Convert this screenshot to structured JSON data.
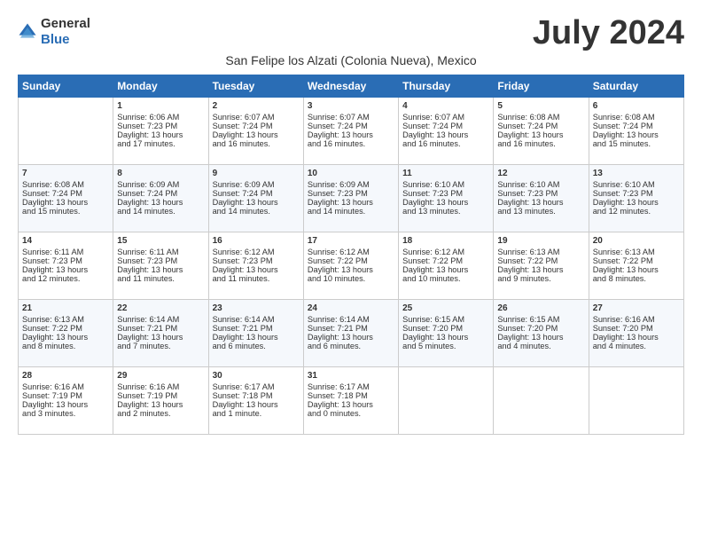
{
  "logo": {
    "general": "General",
    "blue": "Blue"
  },
  "title": "July 2024",
  "subtitle": "San Felipe los Alzati (Colonia Nueva), Mexico",
  "days_of_week": [
    "Sunday",
    "Monday",
    "Tuesday",
    "Wednesday",
    "Thursday",
    "Friday",
    "Saturday"
  ],
  "weeks": [
    [
      {
        "day": "",
        "content": ""
      },
      {
        "day": "1",
        "content": "Sunrise: 6:06 AM\nSunset: 7:23 PM\nDaylight: 13 hours\nand 17 minutes."
      },
      {
        "day": "2",
        "content": "Sunrise: 6:07 AM\nSunset: 7:24 PM\nDaylight: 13 hours\nand 16 minutes."
      },
      {
        "day": "3",
        "content": "Sunrise: 6:07 AM\nSunset: 7:24 PM\nDaylight: 13 hours\nand 16 minutes."
      },
      {
        "day": "4",
        "content": "Sunrise: 6:07 AM\nSunset: 7:24 PM\nDaylight: 13 hours\nand 16 minutes."
      },
      {
        "day": "5",
        "content": "Sunrise: 6:08 AM\nSunset: 7:24 PM\nDaylight: 13 hours\nand 16 minutes."
      },
      {
        "day": "6",
        "content": "Sunrise: 6:08 AM\nSunset: 7:24 PM\nDaylight: 13 hours\nand 15 minutes."
      }
    ],
    [
      {
        "day": "7",
        "content": "Sunrise: 6:08 AM\nSunset: 7:24 PM\nDaylight: 13 hours\nand 15 minutes."
      },
      {
        "day": "8",
        "content": "Sunrise: 6:09 AM\nSunset: 7:24 PM\nDaylight: 13 hours\nand 14 minutes."
      },
      {
        "day": "9",
        "content": "Sunrise: 6:09 AM\nSunset: 7:24 PM\nDaylight: 13 hours\nand 14 minutes."
      },
      {
        "day": "10",
        "content": "Sunrise: 6:09 AM\nSunset: 7:23 PM\nDaylight: 13 hours\nand 14 minutes."
      },
      {
        "day": "11",
        "content": "Sunrise: 6:10 AM\nSunset: 7:23 PM\nDaylight: 13 hours\nand 13 minutes."
      },
      {
        "day": "12",
        "content": "Sunrise: 6:10 AM\nSunset: 7:23 PM\nDaylight: 13 hours\nand 13 minutes."
      },
      {
        "day": "13",
        "content": "Sunrise: 6:10 AM\nSunset: 7:23 PM\nDaylight: 13 hours\nand 12 minutes."
      }
    ],
    [
      {
        "day": "14",
        "content": "Sunrise: 6:11 AM\nSunset: 7:23 PM\nDaylight: 13 hours\nand 12 minutes."
      },
      {
        "day": "15",
        "content": "Sunrise: 6:11 AM\nSunset: 7:23 PM\nDaylight: 13 hours\nand 11 minutes."
      },
      {
        "day": "16",
        "content": "Sunrise: 6:12 AM\nSunset: 7:23 PM\nDaylight: 13 hours\nand 11 minutes."
      },
      {
        "day": "17",
        "content": "Sunrise: 6:12 AM\nSunset: 7:22 PM\nDaylight: 13 hours\nand 10 minutes."
      },
      {
        "day": "18",
        "content": "Sunrise: 6:12 AM\nSunset: 7:22 PM\nDaylight: 13 hours\nand 10 minutes."
      },
      {
        "day": "19",
        "content": "Sunrise: 6:13 AM\nSunset: 7:22 PM\nDaylight: 13 hours\nand 9 minutes."
      },
      {
        "day": "20",
        "content": "Sunrise: 6:13 AM\nSunset: 7:22 PM\nDaylight: 13 hours\nand 8 minutes."
      }
    ],
    [
      {
        "day": "21",
        "content": "Sunrise: 6:13 AM\nSunset: 7:22 PM\nDaylight: 13 hours\nand 8 minutes."
      },
      {
        "day": "22",
        "content": "Sunrise: 6:14 AM\nSunset: 7:21 PM\nDaylight: 13 hours\nand 7 minutes."
      },
      {
        "day": "23",
        "content": "Sunrise: 6:14 AM\nSunset: 7:21 PM\nDaylight: 13 hours\nand 6 minutes."
      },
      {
        "day": "24",
        "content": "Sunrise: 6:14 AM\nSunset: 7:21 PM\nDaylight: 13 hours\nand 6 minutes."
      },
      {
        "day": "25",
        "content": "Sunrise: 6:15 AM\nSunset: 7:20 PM\nDaylight: 13 hours\nand 5 minutes."
      },
      {
        "day": "26",
        "content": "Sunrise: 6:15 AM\nSunset: 7:20 PM\nDaylight: 13 hours\nand 4 minutes."
      },
      {
        "day": "27",
        "content": "Sunrise: 6:16 AM\nSunset: 7:20 PM\nDaylight: 13 hours\nand 4 minutes."
      }
    ],
    [
      {
        "day": "28",
        "content": "Sunrise: 6:16 AM\nSunset: 7:19 PM\nDaylight: 13 hours\nand 3 minutes."
      },
      {
        "day": "29",
        "content": "Sunrise: 6:16 AM\nSunset: 7:19 PM\nDaylight: 13 hours\nand 2 minutes."
      },
      {
        "day": "30",
        "content": "Sunrise: 6:17 AM\nSunset: 7:18 PM\nDaylight: 13 hours\nand 1 minute."
      },
      {
        "day": "31",
        "content": "Sunrise: 6:17 AM\nSunset: 7:18 PM\nDaylight: 13 hours\nand 0 minutes."
      },
      {
        "day": "",
        "content": ""
      },
      {
        "day": "",
        "content": ""
      },
      {
        "day": "",
        "content": ""
      }
    ]
  ]
}
